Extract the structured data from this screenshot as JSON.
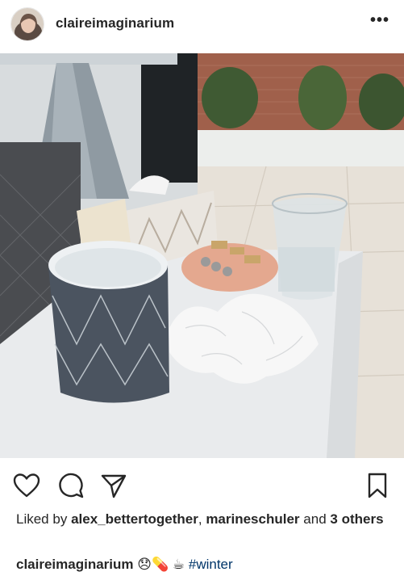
{
  "post": {
    "username": "claireimaginarium",
    "more_label": "•••"
  },
  "likes": {
    "prefix": "Liked by",
    "user1": "alex_bettertogether",
    "sep": ",",
    "user2": "marineschuler",
    "and": "and",
    "others": "3 others"
  },
  "caption": {
    "username": "claireimaginarium",
    "emoji1": "😞",
    "emoji2": "💊",
    "emoji3": "☕",
    "hashtag": "#winter"
  },
  "icons": {
    "like": "heart-outline-icon",
    "comment": "comment-bubble-icon",
    "share": "paper-plane-icon",
    "save": "bookmark-outline-icon",
    "more": "more-options-icon"
  }
}
